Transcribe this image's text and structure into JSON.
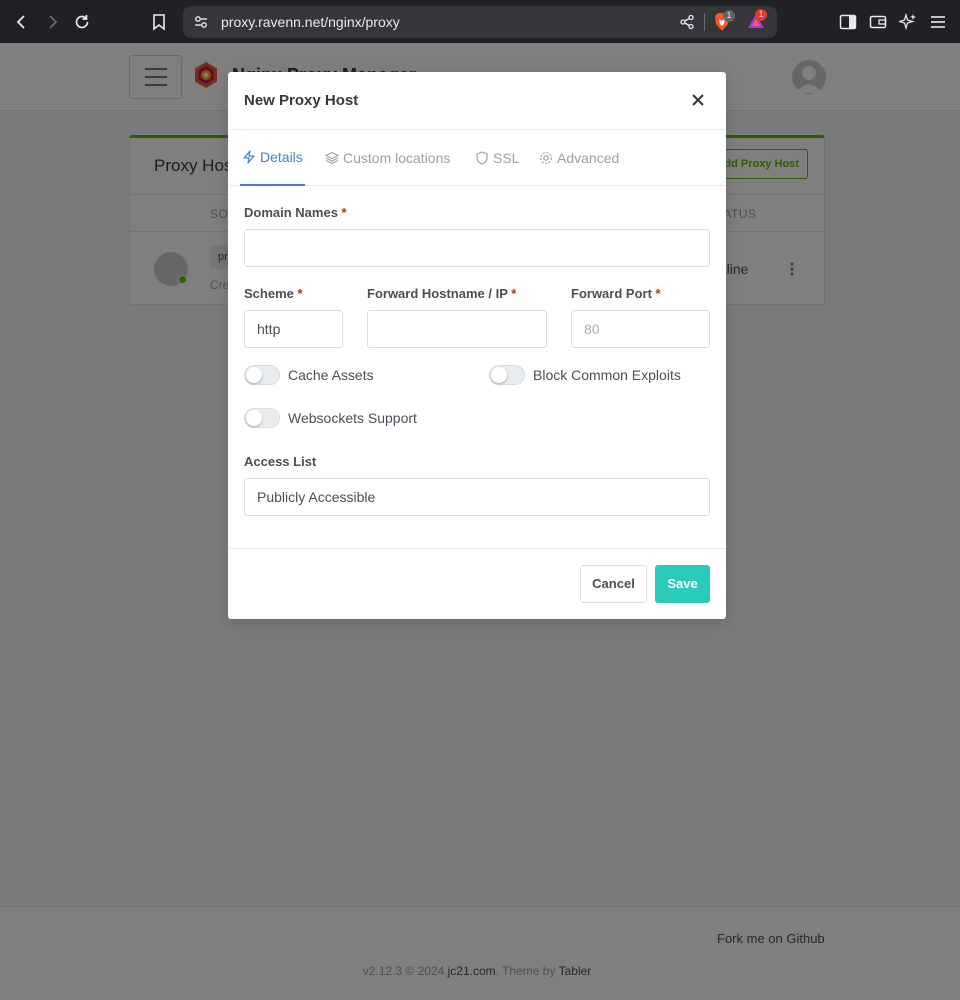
{
  "browser": {
    "url": "proxy.ravenn.net/nginx/proxy",
    "shield_badge": "1",
    "rewards_badge": "1"
  },
  "app": {
    "title": "Nginx Proxy Manager",
    "card_title": "Proxy Hosts",
    "add_button": "Add Proxy Host",
    "columns": [
      "SOURCE",
      "STATUS"
    ],
    "row": {
      "tag": "pr",
      "created": "Cre",
      "status": "Online"
    },
    "footer": {
      "fork": "Fork me on Github",
      "version": "v2.12.3 © 2024 ",
      "author": "jc21.com",
      "theme_prefix": ". Theme by ",
      "theme": "Tabler"
    }
  },
  "modal": {
    "title": "New Proxy Host",
    "tabs": [
      {
        "label": "Details",
        "icon": "zap-icon",
        "active": true
      },
      {
        "label": "Custom locations",
        "icon": "layers-icon",
        "active": false
      },
      {
        "label": "SSL",
        "icon": "shield-icon",
        "active": false
      },
      {
        "label": "Advanced",
        "icon": "gear-icon",
        "active": false
      }
    ],
    "fields": {
      "domain_names": {
        "label": "Domain Names",
        "required": "*",
        "value": ""
      },
      "scheme": {
        "label": "Scheme",
        "required": "*",
        "value": "http"
      },
      "forward_host": {
        "label": "Forward Hostname / IP",
        "required": "*",
        "value": ""
      },
      "forward_port": {
        "label": "Forward Port",
        "required": "*",
        "placeholder": "80"
      }
    },
    "toggles": {
      "cache_assets": {
        "label": "Cache Assets",
        "on": false
      },
      "block_exploits": {
        "label": "Block Common Exploits",
        "on": false
      },
      "websockets": {
        "label": "Websockets Support",
        "on": false
      }
    },
    "access_list": {
      "label": "Access List",
      "value": "Publicly Accessible"
    },
    "buttons": {
      "cancel": "Cancel",
      "save": "Save"
    }
  },
  "colors": {
    "accent": "#467fcf",
    "save": "#2bcbba",
    "success": "#5eba00",
    "required": "#cd201f"
  }
}
